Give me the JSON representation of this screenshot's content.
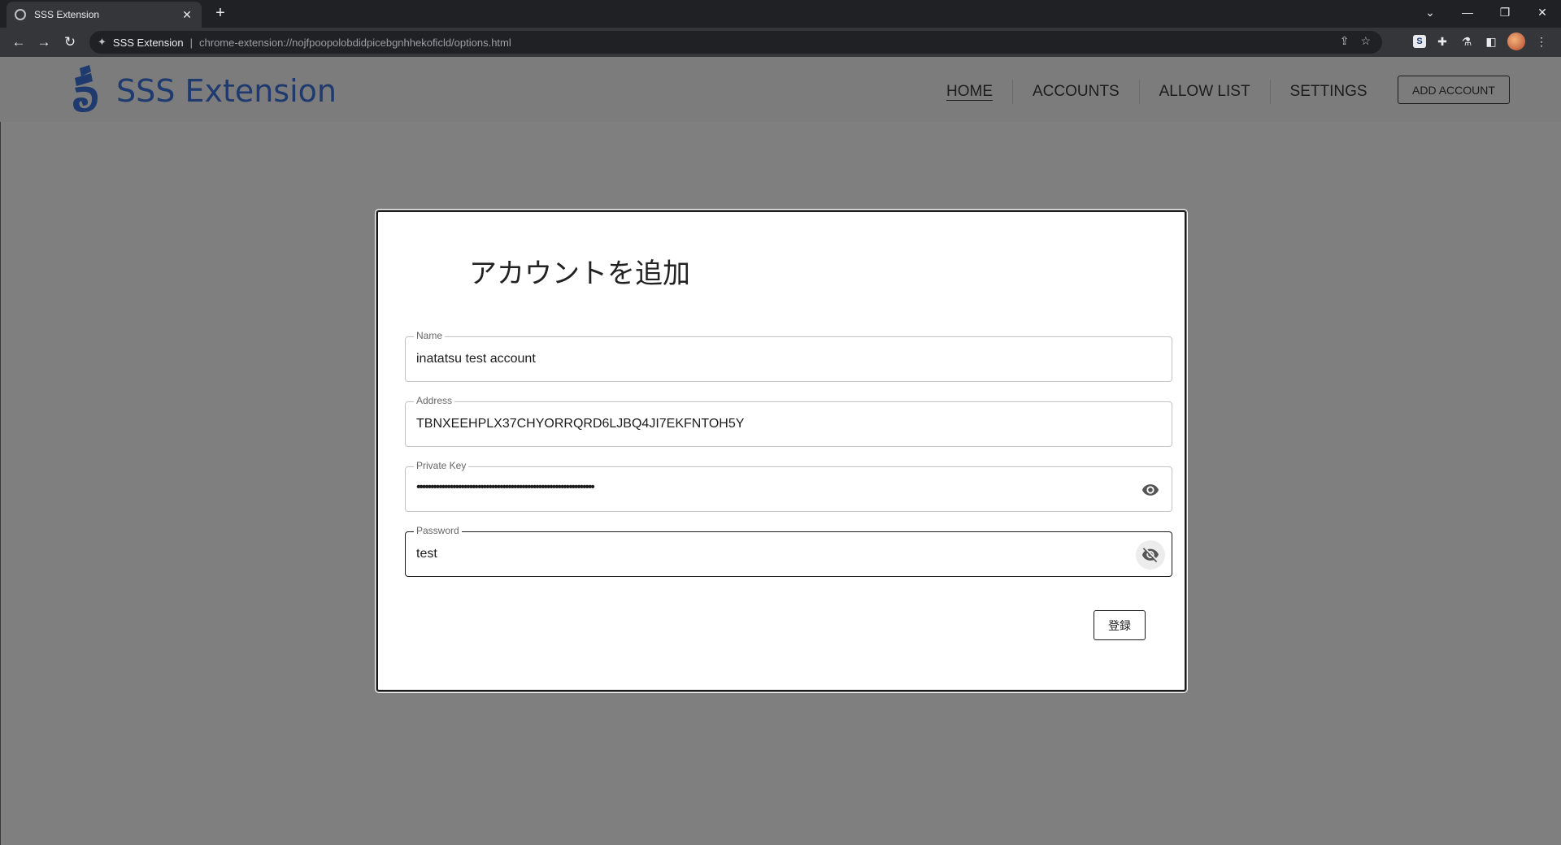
{
  "browser": {
    "tab_title": "SSS Extension",
    "tab_close": "✕",
    "new_tab": "+",
    "site_name": "SSS Extension",
    "separator": "|",
    "url": "chrome-extension://nojfpoopolobdidpicebgnhhekoficld/options.html"
  },
  "header": {
    "brand": "SSS Extension",
    "nav": [
      "HOME",
      "ACCOUNTS",
      "ALLOW LIST",
      "SETTINGS"
    ],
    "active_nav": "HOME",
    "add_account_label": "ADD ACCOUNT"
  },
  "dialog": {
    "title": "アカウントを追加",
    "fields": [
      {
        "label": "Name",
        "value": "inatatsu test account"
      },
      {
        "label": "Address",
        "value": "TBNXEEHPLX37CHYORRQRD6LJBQ4JI7EKFNTOH5Y"
      },
      {
        "label": "Private Key",
        "value": "••••••••••••••••••••••••••••••••••••••••••••••••••••••••••••••••",
        "masked": true
      },
      {
        "label": "Password",
        "value": "test",
        "masked": false
      }
    ],
    "submit_label": "登録"
  },
  "colors": {
    "brand": "#1e3a6e",
    "overlay": "#7f7f7f"
  },
  "icons": {
    "private_key_toggle": "eye-icon",
    "password_toggle": "eye-off-icon"
  }
}
